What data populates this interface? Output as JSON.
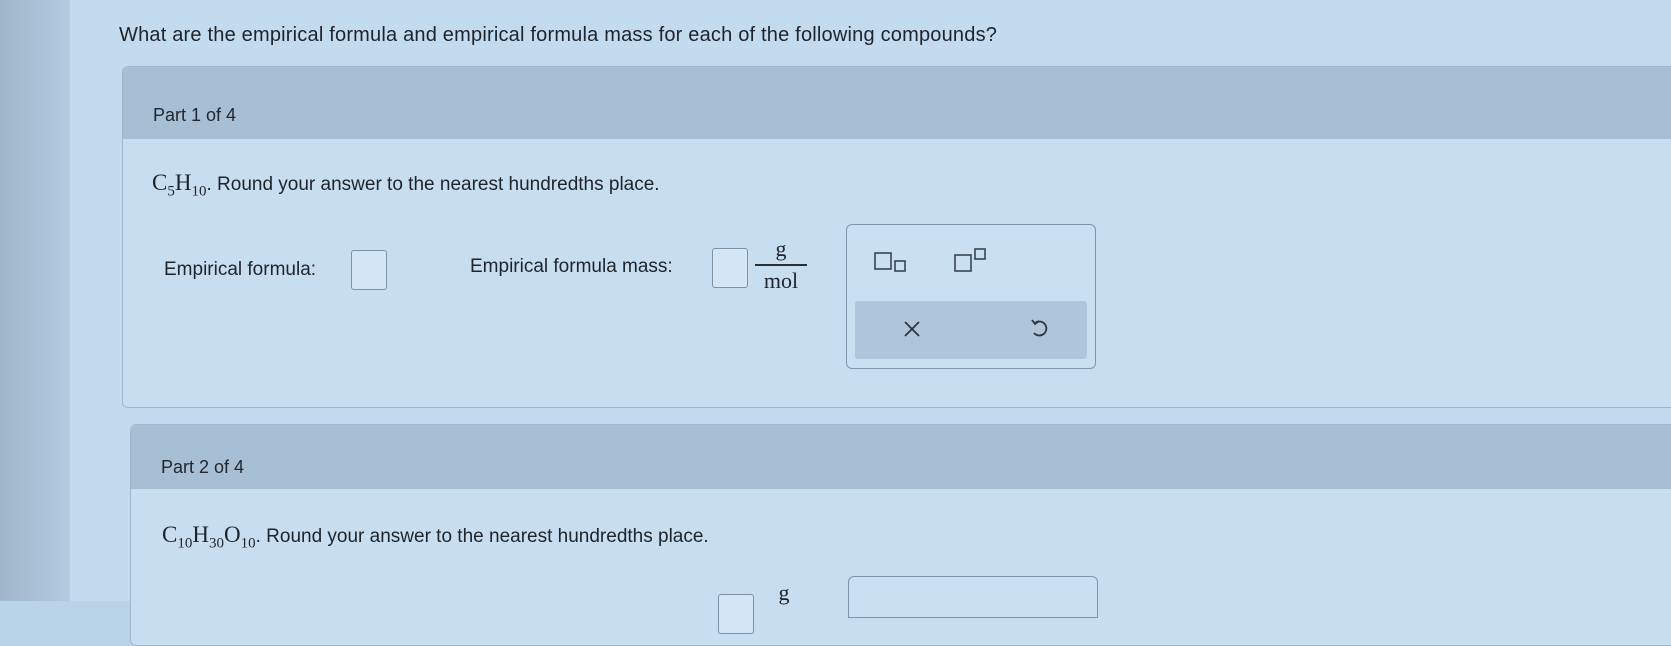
{
  "question": "What are the empirical formula and empirical formula mass for each of the following compounds?",
  "parts": [
    {
      "title": "Part 1 of 4",
      "formula": [
        {
          "el": "C",
          "sub": "5"
        },
        {
          "el": "H",
          "sub": "10"
        }
      ],
      "instruction": ". Round your answer to the nearest hundredths place.",
      "empirical_formula_label": "Empirical formula:",
      "empirical_formula_value": "",
      "empirical_mass_label": "Empirical formula mass:",
      "empirical_mass_value": "",
      "unit_numerator": "g",
      "unit_denominator": "mol"
    },
    {
      "title": "Part 2 of 4",
      "formula": [
        {
          "el": "C",
          "sub": "10"
        },
        {
          "el": "H",
          "sub": "30"
        },
        {
          "el": "O",
          "sub": "10"
        }
      ],
      "instruction": ". Round your answer to the nearest hundredths place.",
      "unit_numerator": "g"
    }
  ],
  "toolbox": {
    "icons": [
      "subscript-icon",
      "superscript-icon",
      "clear-icon",
      "undo-icon"
    ],
    "clear_symbol": "×"
  },
  "colors": {
    "background": "#c3dbef",
    "header": "#a6bfd5",
    "toolbar_row": "#aec6dc"
  }
}
